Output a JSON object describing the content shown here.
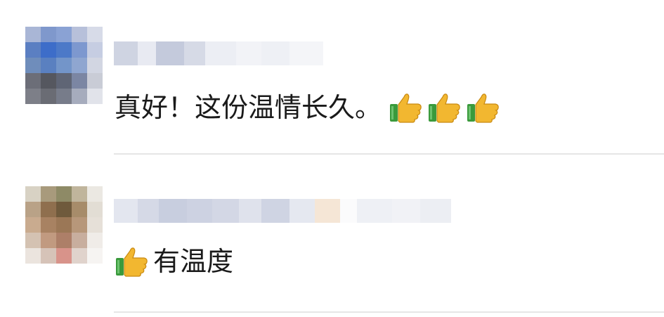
{
  "comments": [
    {
      "text": "真好！这份温情长久。",
      "reaction_icons": [
        "thumbs-up-icon",
        "thumbs-up-icon",
        "thumbs-up-icon"
      ],
      "nickname_blurred": true,
      "avatar_blurred": true
    },
    {
      "text": "有温度",
      "reaction_icons": [
        "thumbs-up-icon"
      ],
      "nickname_blurred": true,
      "avatar_blurred": true
    }
  ],
  "colors": {
    "divider": "#e6e6e6",
    "text": "#1a1a1a",
    "thumb_yellow": "#f2b730",
    "thumb_green": "#3a9a3c"
  }
}
